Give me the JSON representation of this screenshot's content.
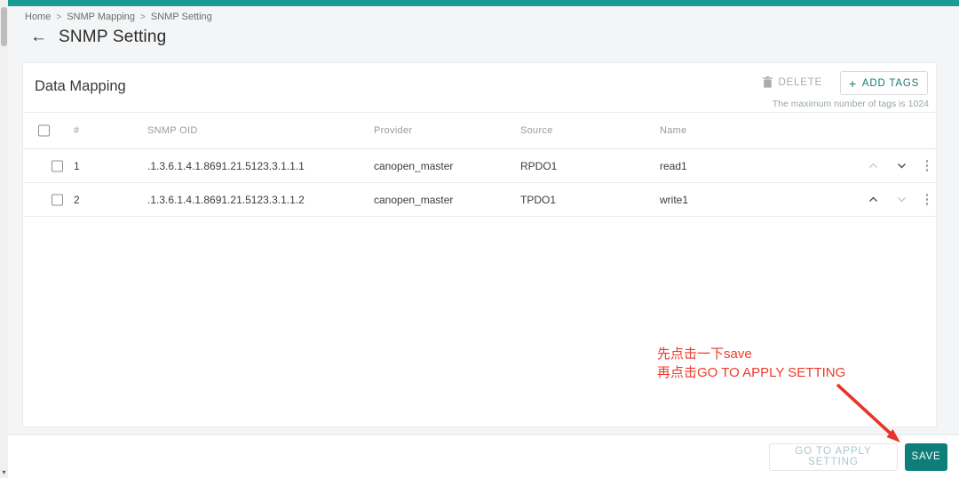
{
  "icons": {
    "back": "←",
    "scrollbar_down": "▾",
    "add_plus": "+"
  },
  "colors": {
    "accent_teal": "#1a9c94",
    "save_button_bg": "#0e7e79",
    "add_tags_text": "#157a76",
    "apply_button_text": "#a5cbc8",
    "annotation_red": "#ee392b"
  },
  "breadcrumb": {
    "separator": ">",
    "items": [
      "Home",
      "SNMP Mapping",
      "SNMP Setting"
    ]
  },
  "page": {
    "title": "SNMP Setting"
  },
  "card": {
    "title": "Data Mapping",
    "delete_label": "DELETE",
    "add_tags_label": "ADD TAGS",
    "max_note": "The maximum number of tags is 1024"
  },
  "table": {
    "columns": {
      "num": "#",
      "oid": "SNMP OID",
      "provider": "Provider",
      "source": "Source",
      "name": "Name"
    },
    "rows": [
      {
        "num": "1",
        "oid": ".1.3.6.1.4.1.8691.21.5123.3.1.1.1",
        "provider": "canopen_master",
        "source": "RPDO1",
        "name": "read1",
        "up_enabled": false,
        "down_enabled": true
      },
      {
        "num": "2",
        "oid": ".1.3.6.1.4.1.8691.21.5123.3.1.1.2",
        "provider": "canopen_master",
        "source": "TPDO1",
        "name": "write1",
        "up_enabled": true,
        "down_enabled": false
      }
    ]
  },
  "annotation": {
    "line1": "先点击一下save",
    "line2": "再点击GO TO APPLY SETTING"
  },
  "footer": {
    "apply_label": "GO TO APPLY SETTING",
    "save_label": "SAVE"
  }
}
